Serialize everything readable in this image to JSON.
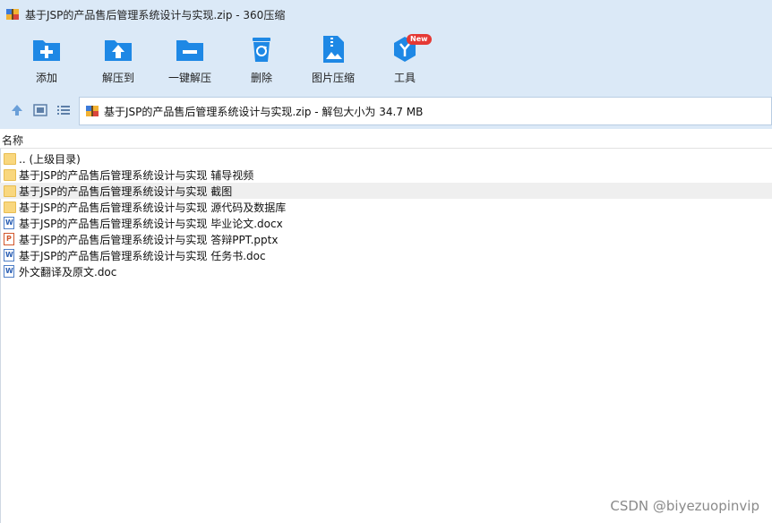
{
  "window": {
    "title": "基于JSP的产品售后管理系统设计与实现.zip - 360压缩"
  },
  "toolbar": {
    "items": [
      {
        "label": "添加",
        "icon": "add-folder-icon"
      },
      {
        "label": "解压到",
        "icon": "extract-to-icon"
      },
      {
        "label": "一键解压",
        "icon": "one-click-extract-icon"
      },
      {
        "label": "删除",
        "icon": "recycle-bin-icon"
      },
      {
        "label": "图片压缩",
        "icon": "image-compress-icon"
      },
      {
        "label": "工具",
        "icon": "tools-icon",
        "badge": "New"
      }
    ]
  },
  "addressbar": {
    "path": "基于JSP的产品售后管理系统设计与实现.zip - 解包大小为 34.7 MB"
  },
  "list": {
    "column_name": "名称",
    "rows": [
      {
        "name": ".. (上级目录)",
        "type": "folder"
      },
      {
        "name": "基于JSP的产品售后管理系统设计与实现 辅导视频",
        "type": "folder"
      },
      {
        "name": "基于JSP的产品售后管理系统设计与实现 截图",
        "type": "folder",
        "selected": true
      },
      {
        "name": "基于JSP的产品售后管理系统设计与实现 源代码及数据库",
        "type": "folder"
      },
      {
        "name": "基于JSP的产品售后管理系统设计与实现 毕业论文.docx",
        "type": "doc"
      },
      {
        "name": "基于JSP的产品售后管理系统设计与实现 答辩PPT.pptx",
        "type": "ppt"
      },
      {
        "name": "基于JSP的产品售后管理系统设计与实现 任务书.doc",
        "type": "doc"
      },
      {
        "name": "外文翻译及原文.doc",
        "type": "doc"
      }
    ]
  },
  "watermark": "CSDN @biyezuopinvip",
  "colors": {
    "toolbar_bg": "#dbe9f7",
    "accent": "#1e88e5",
    "badge": "#e53935"
  }
}
